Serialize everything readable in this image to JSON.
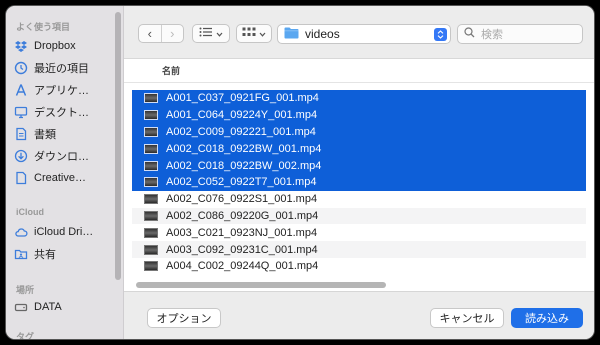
{
  "sidebar": {
    "sections": {
      "favorites": "よく使う項目",
      "icloud": "iCloud",
      "locations": "場所",
      "tags": "タグ"
    },
    "items": [
      {
        "label": "Dropbox",
        "icon": "dropbox-icon"
      },
      {
        "label": "最近の項目",
        "icon": "clock-icon"
      },
      {
        "label": "アプリケ…",
        "icon": "applications-icon"
      },
      {
        "label": "デスクト…",
        "icon": "desktop-icon"
      },
      {
        "label": "書類",
        "icon": "document-icon"
      },
      {
        "label": "ダウンロ…",
        "icon": "download-icon"
      },
      {
        "label": "Creative…",
        "icon": "file-icon"
      },
      {
        "label": "iCloud Dri…",
        "icon": "cloud-icon"
      },
      {
        "label": "共有",
        "icon": "shared-folder-icon"
      },
      {
        "label": "DATA",
        "icon": "drive-icon"
      }
    ]
  },
  "toolbar": {
    "back_glyph": "‹",
    "forward_glyph": "›",
    "location": "videos",
    "search_placeholder": "検索"
  },
  "list": {
    "column_header": "名前",
    "files": [
      {
        "name": "A001_C037_0921FG_001.mp4",
        "selected": true
      },
      {
        "name": "A001_C064_09224Y_001.mp4",
        "selected": true
      },
      {
        "name": "A002_C009_092221_001.mp4",
        "selected": true
      },
      {
        "name": "A002_C018_0922BW_001.mp4",
        "selected": true
      },
      {
        "name": "A002_C018_0922BW_002.mp4",
        "selected": true
      },
      {
        "name": "A002_C052_0922T7_001.mp4",
        "selected": true
      },
      {
        "name": "A002_C076_0922S1_001.mp4",
        "selected": false
      },
      {
        "name": "A002_C086_09220G_001.mp4",
        "selected": false
      },
      {
        "name": "A003_C021_0923NJ_001.mp4",
        "selected": false
      },
      {
        "name": "A003_C092_09231C_001.mp4",
        "selected": false
      },
      {
        "name": "A004_C002_09244Q_001.mp4",
        "selected": false
      }
    ]
  },
  "footer": {
    "options_label": "オプション",
    "cancel_label": "キャンセル",
    "open_label": "読み込み"
  },
  "colors": {
    "accent": "#1f6fe8",
    "selection": "#0e5fd8",
    "folder": "#5aa7f0"
  }
}
